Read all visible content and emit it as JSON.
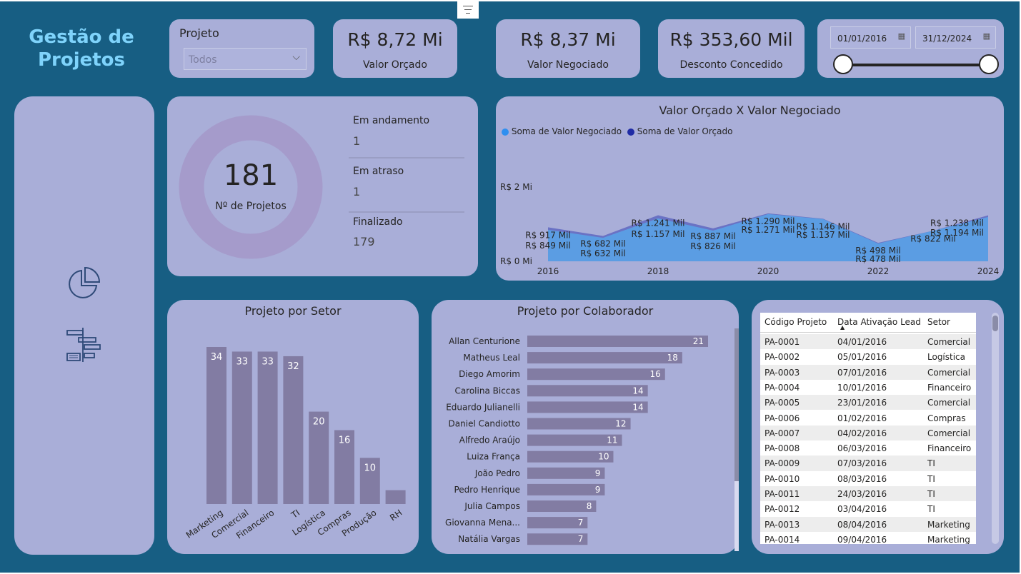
{
  "brand": {
    "line1": "Gestão de",
    "line2": "Projetos"
  },
  "filter_project": {
    "title": "Projeto",
    "selected": "Todos"
  },
  "kpis": [
    {
      "value": "R$ 8,72 Mi",
      "label": "Valor Orçado"
    },
    {
      "value": "R$ 8,37 Mi",
      "label": "Valor Negociado"
    },
    {
      "value": "R$ 353,60 Mil",
      "label": "Desconto Concedido"
    }
  ],
  "date_filter": {
    "start": "01/01/2016",
    "end": "31/12/2024",
    "range_fraction": [
      0,
      1
    ]
  },
  "donut": {
    "value": "181",
    "label": "Nº de Projetos"
  },
  "status": [
    {
      "label": "Em andamento",
      "value": "1"
    },
    {
      "label": "Em atraso",
      "value": "1"
    },
    {
      "label": "Finalizado",
      "value": "179"
    }
  ],
  "icons": {
    "pie": "pie-chart-icon",
    "gantt": "gantt-chart-icon"
  },
  "colors": {
    "canvas": "#175e83",
    "card": "#a9aed8",
    "brand": "#7fd3fb",
    "negociado": "#5b9de3",
    "orcado": "#6a72c4",
    "bar": "#827ca3",
    "legend_negociado": "#2f8ff0",
    "legend_orcado": "#1f2ba5"
  },
  "chart_data": [
    {
      "type": "area",
      "title": "Valor Orçado X Valor Negociado",
      "x": [
        2016,
        2017,
        2018,
        2019,
        2020,
        2021,
        2022,
        2023,
        2024
      ],
      "x_ticks": [
        "2016",
        "2018",
        "2020",
        "2022",
        "2024"
      ],
      "y_ticks": [
        "R$ 0 Mi",
        "R$ 2 Mi"
      ],
      "y_tick_values": [
        0,
        2000
      ],
      "ylim": [
        0,
        2400
      ],
      "series": [
        {
          "name": "Soma de Valor Negociado",
          "values": [
            849,
            632,
            1157,
            826,
            1271,
            1137,
            478,
            822,
            1194
          ],
          "labels": [
            "R$ 849 Mil",
            "R$ 632 Mil",
            "R$ 1.157 Mil",
            "R$ 826 Mil",
            "R$ 1.271 Mil",
            "R$ 1.137 Mil",
            "R$ 478 Mil",
            "",
            "R$ 1.194 Mil"
          ]
        },
        {
          "name": "Soma de Valor Orçado",
          "values": [
            917,
            682,
            1241,
            887,
            1290,
            1146,
            498,
            822,
            1238
          ],
          "labels": [
            "R$ 917 Mil",
            "R$ 682 Mil",
            "R$ 1.241 Mil",
            "R$ 887 Mil",
            "R$ 1.290 Mil",
            "R$ 1.146 Mil",
            "R$ 498 Mil",
            "R$ 822 Mil",
            "R$ 1.238 Mil"
          ]
        }
      ],
      "legend": "top-left"
    },
    {
      "type": "bar",
      "title": "Projeto por Setor",
      "categories": [
        "Marketing",
        "Comercial",
        "Financeiro",
        "TI",
        "Logística",
        "Compras",
        "Produção",
        "RH"
      ],
      "values": [
        34,
        33,
        33,
        32,
        20,
        16,
        10,
        3
      ],
      "labels": [
        "34",
        "33",
        "33",
        "32",
        "20",
        "16",
        "10",
        ""
      ]
    },
    {
      "type": "bar",
      "orientation": "horizontal",
      "title": "Projeto por Colaborador",
      "categories": [
        "Allan Centurione",
        "Matheus Leal",
        "Diego Amorim",
        "Carolina Biccas",
        "Eduardo Julianelli",
        "Daniel Candiotto",
        "Alfredo Araújo",
        "Luiza França",
        "João Pedro",
        "Pedro Henrique",
        "Julia Campos",
        "Giovanna Mena...",
        "Natália Vargas"
      ],
      "values": [
        21,
        18,
        16,
        14,
        14,
        12,
        11,
        10,
        9,
        9,
        8,
        7,
        7
      ]
    }
  ],
  "table": {
    "headers": [
      "Código Projeto",
      "Data Ativação Lead",
      "Setor"
    ],
    "rows": [
      [
        "PA-0001",
        "04/01/2016",
        "Comercial"
      ],
      [
        "PA-0002",
        "05/01/2016",
        "Logística"
      ],
      [
        "PA-0003",
        "07/01/2016",
        "Comercial"
      ],
      [
        "PA-0004",
        "10/01/2016",
        "Financeiro"
      ],
      [
        "PA-0005",
        "23/01/2016",
        "Comercial"
      ],
      [
        "PA-0006",
        "01/02/2016",
        "Compras"
      ],
      [
        "PA-0007",
        "04/02/2016",
        "Comercial"
      ],
      [
        "PA-0008",
        "06/03/2016",
        "Financeiro"
      ],
      [
        "PA-0009",
        "07/03/2016",
        "TI"
      ],
      [
        "PA-0010",
        "08/03/2016",
        "TI"
      ],
      [
        "PA-0011",
        "24/03/2016",
        "TI"
      ],
      [
        "PA-0012",
        "03/04/2016",
        "TI"
      ],
      [
        "PA-0013",
        "08/04/2016",
        "Marketing"
      ],
      [
        "PA-0014",
        "09/04/2016",
        "Marketing"
      ]
    ]
  }
}
